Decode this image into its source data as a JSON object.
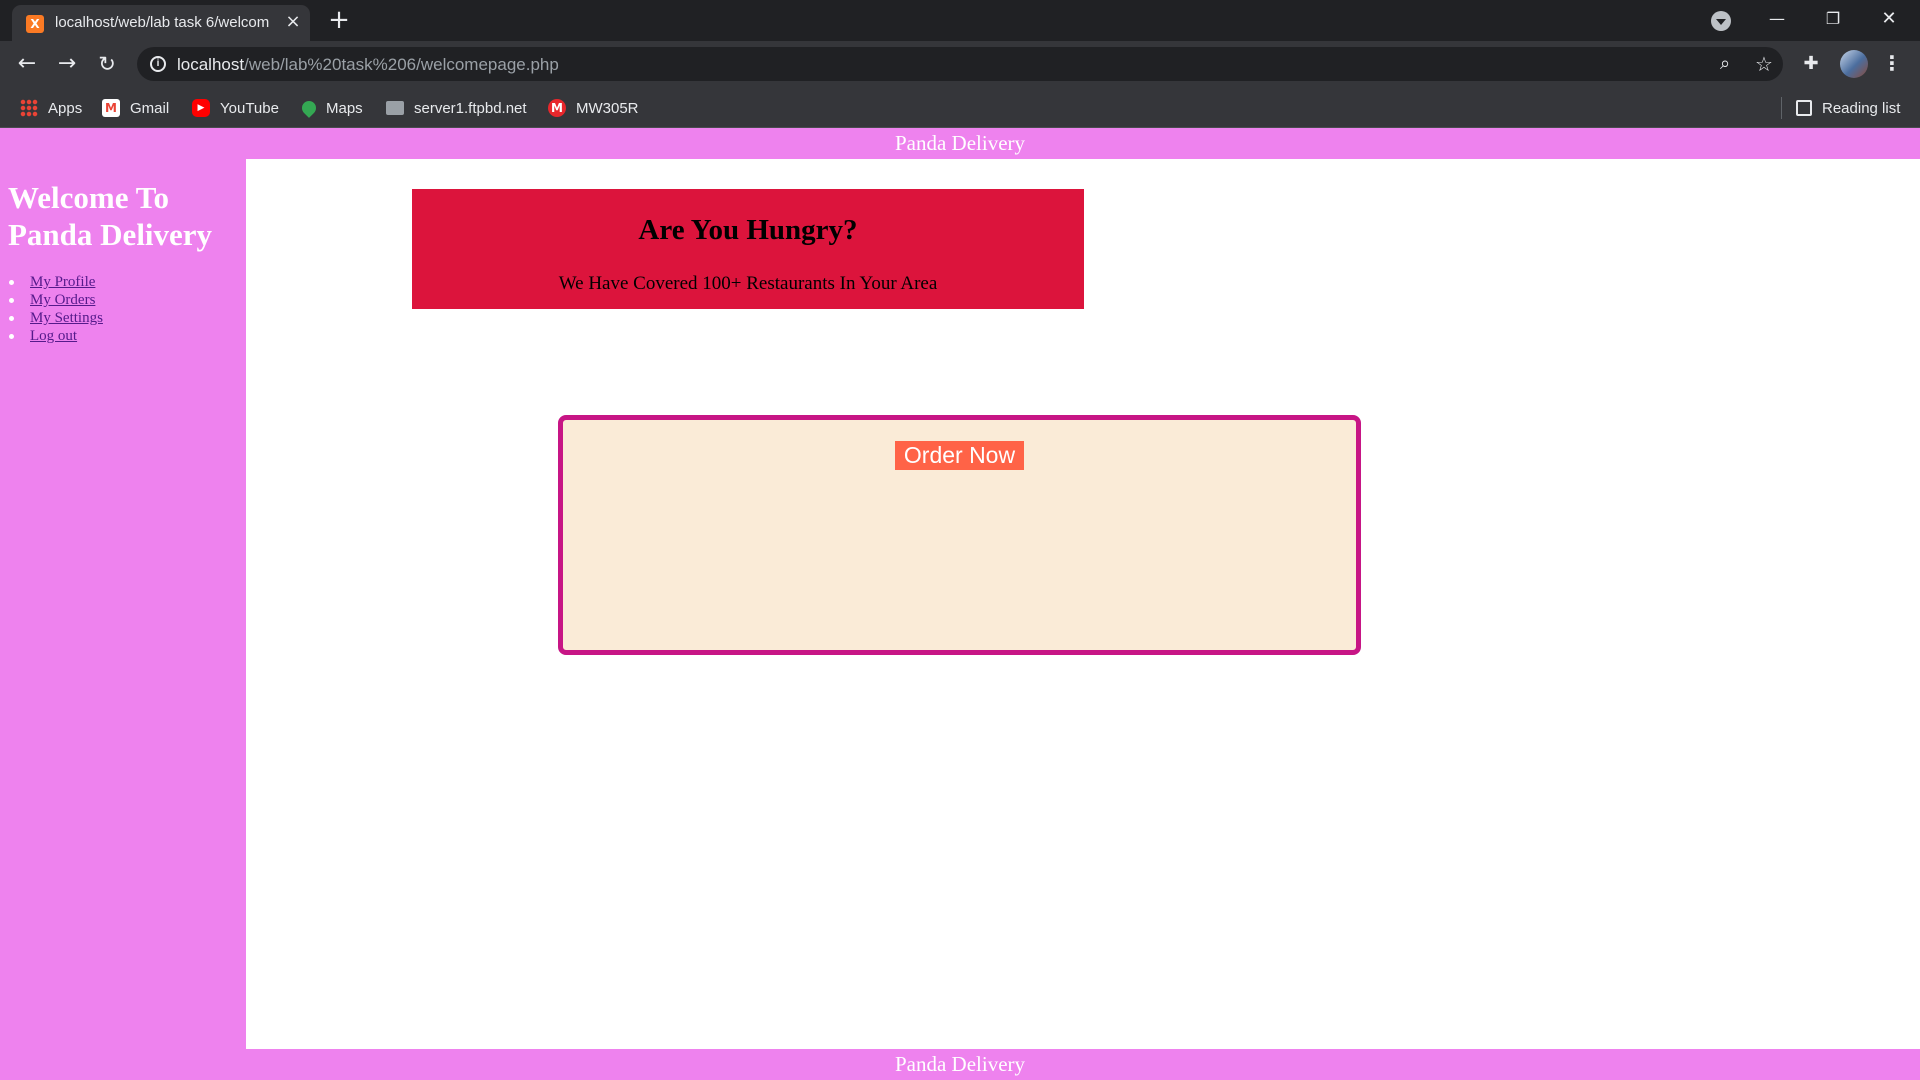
{
  "browser": {
    "tab_title": "localhost/web/lab task 6/welcom",
    "favicon_letter": "⊠",
    "url_host": "localhost",
    "url_path": "/web/lab%20task%206/welcomepage.php",
    "bookmarks": [
      {
        "label": "Apps",
        "icon": "apps-grid-icon"
      },
      {
        "label": "Gmail",
        "icon": "gmail-icon"
      },
      {
        "label": "YouTube",
        "icon": "youtube-icon"
      },
      {
        "label": "Maps",
        "icon": "maps-icon"
      },
      {
        "label": "server1.ftpbd.net",
        "icon": "folder-icon"
      },
      {
        "label": "MW305R",
        "icon": "mw-icon"
      }
    ],
    "reading_list_label": "Reading list"
  },
  "page": {
    "top_banner": "Panda Delivery",
    "sidebar_title": "Welcome To Panda Delivery",
    "nav_links": [
      "My Profile",
      "My Orders",
      "My Settings",
      "Log out"
    ],
    "hero_title": "Are You Hungry?",
    "hero_subtitle": "We Have Covered 100+ Restaurants In Your Area",
    "order_button": "Order Now",
    "bottom_banner": "Panda Delivery"
  },
  "colors": {
    "banner": "#ee82ee",
    "hero_bg": "#dc143c",
    "order_box_bg": "#faebd7",
    "order_box_border": "#c71585",
    "order_button_bg": "#ff6347"
  }
}
